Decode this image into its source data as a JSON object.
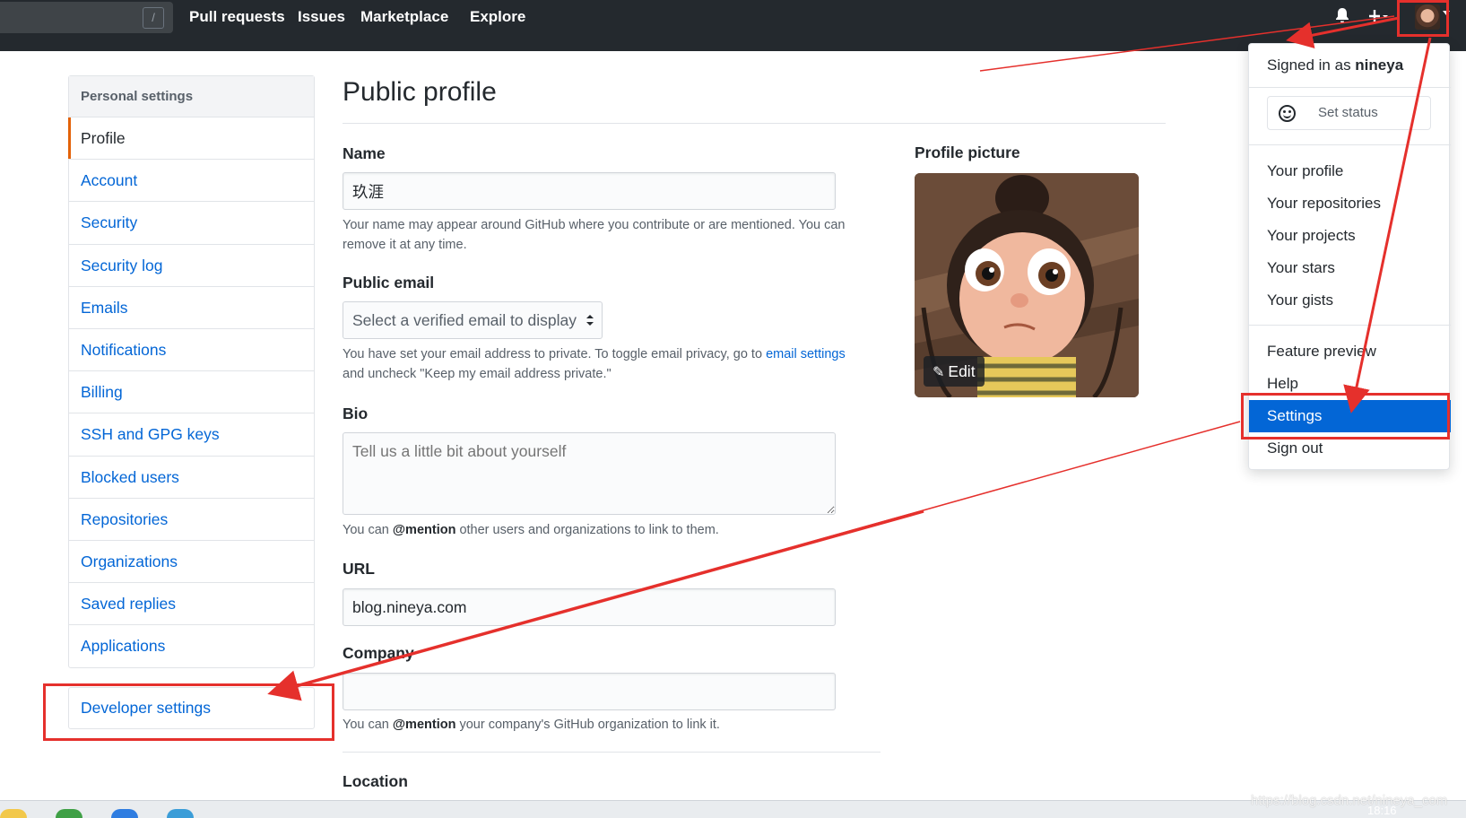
{
  "header": {
    "slash_key": "/",
    "nav": [
      "Pull requests",
      "Issues",
      "Marketplace",
      "Explore"
    ],
    "icons": [
      "bell-icon",
      "plus-icon",
      "avatar"
    ]
  },
  "sidebar": {
    "heading": "Personal settings",
    "items": [
      "Profile",
      "Account",
      "Security",
      "Security log",
      "Emails",
      "Notifications",
      "Billing",
      "SSH and GPG keys",
      "Blocked users",
      "Repositories",
      "Organizations",
      "Saved replies",
      "Applications"
    ],
    "selected": "Profile",
    "developer_settings": "Developer settings"
  },
  "main": {
    "title": "Public profile",
    "name": {
      "label": "Name",
      "value": "玖涯",
      "note": "Your name may appear around GitHub where you contribute or are mentioned. You can remove it at any time."
    },
    "public_email": {
      "label": "Public email",
      "selected": "Select a verified email to display",
      "note_before_link": "You have set your email address to private. To toggle email privacy, go to ",
      "note_link": "email settings",
      "note_after_link": " and uncheck \"Keep my email address private.\""
    },
    "bio": {
      "label": "Bio",
      "placeholder": "Tell us a little bit about yourself",
      "note_before": "You can ",
      "note_bold": "@mention",
      "note_after": " other users and organizations to link to them."
    },
    "url": {
      "label": "URL",
      "value": "blog.nineya.com"
    },
    "company": {
      "label": "Company",
      "value": "",
      "note_before": "You can ",
      "note_bold": "@mention",
      "note_after": " your company's GitHub organization to link it."
    },
    "location": {
      "label": "Location"
    },
    "profile_picture": {
      "label": "Profile picture",
      "edit_label": "Edit"
    }
  },
  "dropdown": {
    "signed_in_prefix": "Signed in as ",
    "username": "nineya",
    "set_status": "Set status",
    "group1": [
      "Your profile",
      "Your repositories",
      "Your projects",
      "Your stars",
      "Your gists"
    ],
    "group2": [
      "Feature preview",
      "Help",
      "Settings",
      "Sign out"
    ],
    "active": "Settings"
  },
  "taskbar": {
    "time": "18:16",
    "watermark": "https://blog.csdn.net/nineya_com"
  },
  "colors": {
    "header_bg": "#24292e",
    "link": "#0366d6",
    "selected_accent": "#e36209",
    "annotation_red": "#e5302c",
    "menu_active": "#0366d6"
  }
}
